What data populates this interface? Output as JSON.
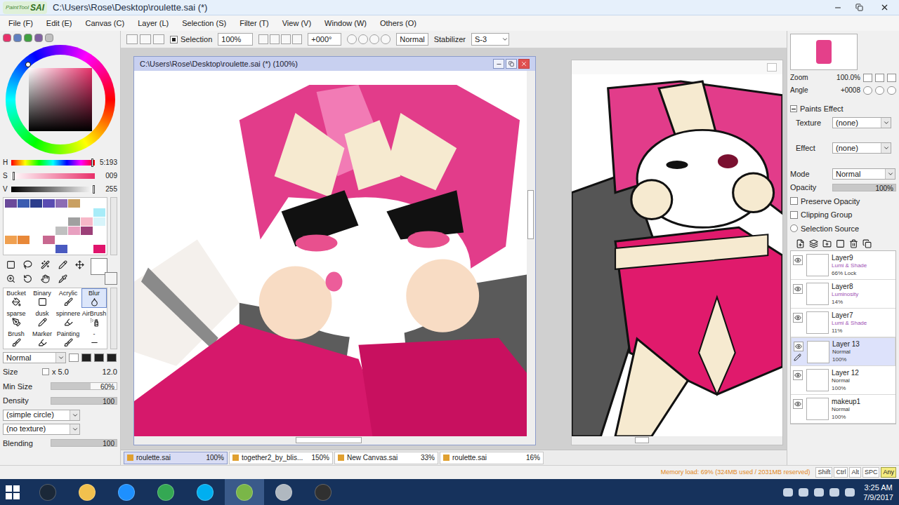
{
  "window": {
    "app": "PaintTool",
    "badge": "SAI",
    "title": "C:\\Users\\Rose\\Desktop\\roulette.sai (*)"
  },
  "menu": [
    "File (F)",
    "Edit (E)",
    "Canvas (C)",
    "Layer (L)",
    "Selection (S)",
    "Filter (T)",
    "View (V)",
    "Window (W)",
    "Others (O)"
  ],
  "toolbar": {
    "selection_label": "Selection",
    "selection_checked": true,
    "zoom": "100%",
    "angle": "+000°",
    "mode": "Normal",
    "stabilizer_label": "Stabilizer",
    "stabilizer": "S-3"
  },
  "color_sliders": [
    {
      "label": "H",
      "value": "5:193",
      "level": 0.98
    },
    {
      "label": "S",
      "value": "009",
      "level": 0.04
    },
    {
      "label": "V",
      "value": "255",
      "level": 1
    }
  ],
  "swatches": [
    "#6b4a9a",
    "#3b5cb0",
    "#2c3d8c",
    "#5a4cb2",
    "#8c6cb4",
    "#c9a062",
    "#ffffff",
    "#ffffff",
    "#ffffff",
    "#ffffff",
    "#ffffff",
    "#ffffff",
    "#ffffff",
    "#ffffff",
    "#ffffff",
    "#a8ecf8",
    "#ffffff",
    "#ffffff",
    "#ffffff",
    "#ffffff",
    "#ffffff",
    "#a0a0a0",
    "#f6b8c8",
    "#d8f4fa",
    "#ffffff",
    "#ffffff",
    "#ffffff",
    "#ffffff",
    "#c0c0c0",
    "#e8a0c0",
    "#9c4078",
    "#ffffff",
    "#f0a050",
    "#e88838",
    "#ffffff",
    "#c86890",
    "#ffffff",
    "#ffffff",
    "#ffffff",
    "#ffffff",
    "#ffffff",
    "#ffffff",
    "#ffffff",
    "#ffffff",
    "#4a5ac0",
    "#ffffff",
    "#ffffff",
    "#e0146c"
  ],
  "brushes": [
    {
      "label": "Bucket",
      "selected": false
    },
    {
      "label": "Binary",
      "selected": false
    },
    {
      "label": "Acrylic",
      "selected": false
    },
    {
      "label": "Blur",
      "selected": true
    },
    {
      "label": "sparse",
      "selected": false
    },
    {
      "label": "dusk",
      "selected": false
    },
    {
      "label": "spinnere",
      "selected": false
    },
    {
      "label": "AirBrush",
      "selected": false
    },
    {
      "label": "Brush",
      "selected": false
    },
    {
      "label": "Marker",
      "selected": false
    },
    {
      "label": "Painting",
      "selected": false
    },
    {
      "label": "-",
      "selected": false
    }
  ],
  "brush_settings": {
    "mode": "Normal",
    "size_label": "Size",
    "size_multiplier": "x 5.0",
    "size": "12.0",
    "min_size_label": "Min Size",
    "min_size": "60%",
    "min_size_level": 0.6,
    "density_label": "Density",
    "density": "100",
    "density_level": 1,
    "shape": "(simple circle)",
    "texture": "(no texture)",
    "blending_label": "Blending",
    "blending": "100",
    "blending_level": 1
  },
  "documents": [
    {
      "title": "C:\\Users\\Rose\\Desktop\\roulette.sai (*) (100%)",
      "active": true
    },
    {
      "title": "",
      "active": false
    }
  ],
  "doc_tabs": [
    {
      "label": "roulette.sai",
      "zoom": "100%",
      "selected": true
    },
    {
      "label": "together2_by_blis...",
      "zoom": "150%",
      "selected": false
    },
    {
      "label": "New Canvas.sai",
      "zoom": "33%",
      "selected": false
    },
    {
      "label": "roulette.sai",
      "zoom": "16%",
      "selected": false
    }
  ],
  "navigator": {
    "zoom_label": "Zoom",
    "zoom": "100.0%",
    "angle_label": "Angle",
    "angle": "+0008"
  },
  "paints_effect": {
    "title": "Paints Effect",
    "expanded": true,
    "texture_label": "Texture",
    "texture": "(none)",
    "effect_label": "Effect",
    "effect": "(none)"
  },
  "layer_props": {
    "mode_label": "Mode",
    "mode": "Normal",
    "opacity_label": "Opacity",
    "opacity": "100%",
    "opacity_level": 1,
    "options": [
      {
        "label": "Preserve Opacity",
        "checked": false
      },
      {
        "label": "Clipping Group",
        "checked": false
      },
      {
        "label": "Selection Source",
        "checked": false
      }
    ]
  },
  "layers": [
    {
      "name": "Layer9",
      "mode": "Lumi & Shade",
      "opacity": "66%",
      "lock": "Lock",
      "visible": true,
      "selected": false,
      "color": "#a04fb4"
    },
    {
      "name": "Layer8",
      "mode": "Luminosity",
      "opacity": "14%",
      "lock": "",
      "visible": true,
      "selected": false,
      "color": "#a04fb4"
    },
    {
      "name": "Layer7",
      "mode": "Lumi & Shade",
      "opacity": "11%",
      "lock": "",
      "visible": true,
      "selected": false,
      "color": "#a04fb4"
    },
    {
      "name": "Layer 13",
      "mode": "Normal",
      "opacity": "100%",
      "lock": "",
      "visible": true,
      "selected": true,
      "color": "#333333"
    },
    {
      "name": "Layer 12",
      "mode": "Normal",
      "opacity": "100%",
      "lock": "",
      "visible": true,
      "selected": false,
      "color": "#333333"
    },
    {
      "name": "makeup1",
      "mode": "Normal",
      "opacity": "100%",
      "lock": "",
      "visible": true,
      "selected": false,
      "color": "#333333"
    }
  ],
  "status": {
    "memory": "Memory load: 69% (324MB used / 2031MB reserved)",
    "keys": [
      {
        "label": "Shift",
        "active": false
      },
      {
        "label": "Ctrl",
        "active": false
      },
      {
        "label": "Alt",
        "active": false
      },
      {
        "label": "SPC",
        "active": false
      },
      {
        "label": "Any",
        "active": true
      }
    ]
  },
  "taskbar": {
    "time": "3:25 AM",
    "date": "7/9/2017",
    "apps": [
      {
        "color": "#1b2838",
        "selected": false
      },
      {
        "color": "#f2c14e",
        "selected": false
      },
      {
        "color": "#1e90ff",
        "selected": false
      },
      {
        "color": "#34a853",
        "selected": false
      },
      {
        "color": "#00aff0",
        "selected": false
      },
      {
        "color": "#7ab648",
        "selected": true
      },
      {
        "color": "#b0b8c0",
        "selected": false
      },
      {
        "color": "#303030",
        "selected": false
      }
    ]
  }
}
